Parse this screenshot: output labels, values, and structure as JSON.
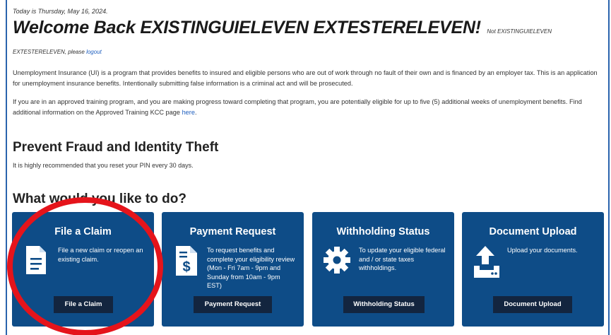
{
  "header": {
    "date_line": "Today is Thursday, May 16, 2024.",
    "welcome": "Welcome Back EXISTINGUIELEVEN EXTESTERELEVEN!",
    "not_user_prefix": "Not EXISTINGUIELEVEN",
    "not_user_name": "EXTESTERELEVEN, please",
    "logout_label": "logout"
  },
  "intro": {
    "paragraph1": "Unemployment Insurance (UI) is a program that provides benefits to insured and eligible persons who are out of work through no fault of their own and is financed by an employer tax. This is an application for unemployment insurance benefits. Intentionally submitting false information is a criminal act and will be prosecuted.",
    "paragraph2_prefix": "If you are in an approved training program, and you are making progress toward completing that program, you are potentially eligible for up to five (5) additional weeks of unemployment benefits. Find additional information on the Approved Training KCC page",
    "paragraph2_link": "here",
    "paragraph2_suffix": "."
  },
  "fraud": {
    "heading": "Prevent Fraud and Identity Theft",
    "text": "It is highly recommended that you reset your PIN every 30 days."
  },
  "actions": {
    "heading": "What would you like to do?",
    "cards": [
      {
        "title": "File a Claim",
        "description": "File a new claim or reopen an existing claim.",
        "button": "File a Claim",
        "icon": "document-icon"
      },
      {
        "title": "Payment Request",
        "description": "To request benefits and complete your eligibility review (Mon - Fri 7am - 9pm and Sunday from 10am - 9pm EST)",
        "button": "Payment Request",
        "icon": "invoice-dollar-icon"
      },
      {
        "title": "Withholding Status",
        "description": "To update your eligible federal and / or state taxes withholdings.",
        "button": "Withholding Status",
        "icon": "gear-icon"
      },
      {
        "title": "Document Upload",
        "description": "Upload your documents.",
        "button": "Document Upload",
        "icon": "upload-icon"
      }
    ]
  },
  "colors": {
    "card_bg": "#0e4c87",
    "button_bg": "#13253f",
    "annotation_ring": "#e5141b",
    "link": "#1f5fbf"
  }
}
